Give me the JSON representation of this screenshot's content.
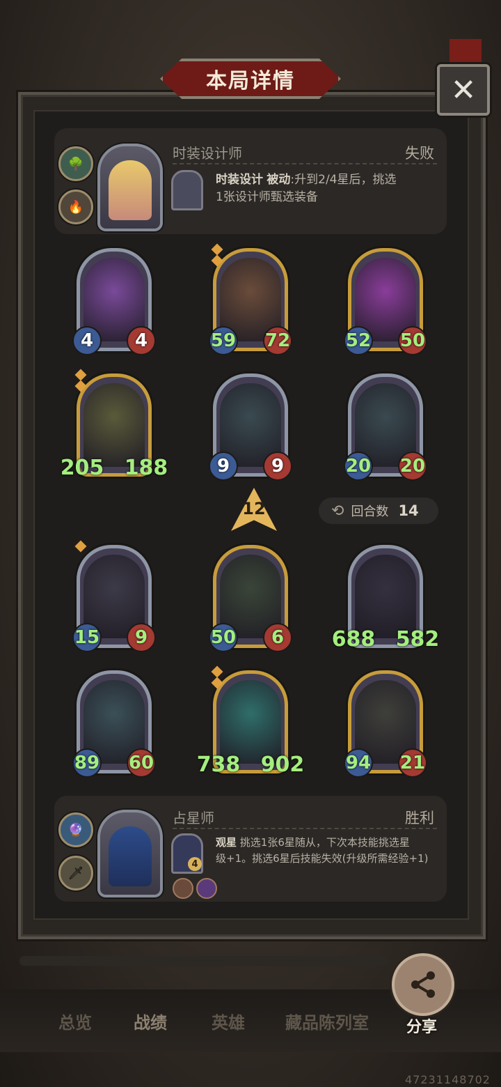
{
  "dialog": {
    "title": "本局详情",
    "close_symbol": "✕"
  },
  "player_top": {
    "hero_name": "时装设计师",
    "result": "失败",
    "skill_name": "时装设计",
    "skill_type": "被动",
    "skill_desc_line1": ":升到2/4星后，挑选",
    "skill_desc_line2": "1张设计师甄选装备"
  },
  "top_board": [
    {
      "atk": "4",
      "hp": "4",
      "gold": false,
      "color": "#7a4a9a",
      "tiers": 0
    },
    {
      "atk": "59",
      "hp": "72",
      "gold": true,
      "color": "#6a4c3a",
      "tiers": 2
    },
    {
      "atk": "52",
      "hp": "50",
      "gold": true,
      "color": "#8a3d9a",
      "tiers": 0
    },
    {
      "atk": "205",
      "hp": "188",
      "gold": true,
      "color": "#5a5a3a",
      "tiers": 2
    },
    {
      "atk": "9",
      "hp": "9",
      "gold": false,
      "color": "#3a4a50",
      "tiers": 0
    },
    {
      "atk": "20",
      "hp": "20",
      "gold": false,
      "color": "#3a4a50",
      "tiers": 0
    }
  ],
  "level_arrow": "12",
  "rounds": {
    "label": "回合数",
    "count": "14",
    "icon": "refresh-icon"
  },
  "bottom_board": [
    {
      "atk": "15",
      "hp": "9",
      "gold": false,
      "color": "#3d3a48",
      "tiers": 1
    },
    {
      "atk": "50",
      "hp": "6",
      "gold": true,
      "color": "#3a4538",
      "tiers": 0
    },
    {
      "atk": "688",
      "hp": "582",
      "gold": false,
      "color": "#35303f",
      "tiers": 0
    },
    {
      "atk": "89",
      "hp": "60",
      "gold": false,
      "color": "#3b5058",
      "tiers": 0
    },
    {
      "atk": "738",
      "hp": "902",
      "gold": true,
      "color": "#2f6e6a",
      "tiers": 2
    },
    {
      "atk": "94",
      "hp": "21",
      "gold": true,
      "color": "#3f3f3a",
      "tiers": 0
    }
  ],
  "player_bottom": {
    "hero_name": "占星师",
    "result": "胜利",
    "skill_name": "观星",
    "skill_desc_line1": "挑选1张6星随从，下次本技能挑选星",
    "skill_desc_line2": "级+1。挑选6星后技能失效(升级所需经验+1)",
    "skill_cost": "4"
  },
  "nav": {
    "items": [
      "总览",
      "战绩",
      "英雄",
      "藏品陈列室"
    ],
    "active": "战绩"
  },
  "share": {
    "label": "分享"
  },
  "uid": "47231148702"
}
